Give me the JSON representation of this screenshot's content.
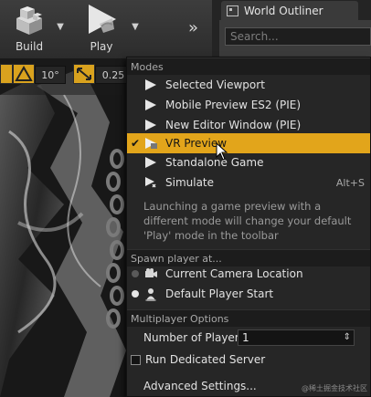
{
  "toolbar": {
    "build_label": "Build",
    "play_label": "Play",
    "overflow_glyph": "»",
    "dropdown_glyph": "▼"
  },
  "outliner": {
    "tab_title": "World Outliner",
    "search_placeholder": "Search..."
  },
  "viewport": {
    "angle_snap": "10°",
    "scale_snap": "0.25"
  },
  "menu": {
    "modes_header": "Modes",
    "modes": [
      {
        "label": "Selected Viewport",
        "icon": "play-icon",
        "checked": false,
        "shortcut": ""
      },
      {
        "label": "Mobile Preview ES2 (PIE)",
        "icon": "play-icon",
        "checked": false,
        "shortcut": ""
      },
      {
        "label": "New Editor Window (PIE)",
        "icon": "play-icon",
        "checked": false,
        "shortcut": ""
      },
      {
        "label": "VR Preview",
        "icon": "vr-headset-icon",
        "checked": true,
        "shortcut": ""
      },
      {
        "label": "Standalone Game",
        "icon": "play-icon",
        "checked": false,
        "shortcut": ""
      },
      {
        "label": "Simulate",
        "icon": "simulate-icon",
        "checked": false,
        "shortcut": "Alt+S"
      }
    ],
    "note": "Launching a game preview with a different mode will change your default 'Play' mode in the toolbar",
    "spawn_header": "Spawn player at...",
    "spawn": [
      {
        "label": "Current Camera Location",
        "icon": "camera-icon",
        "selected": false
      },
      {
        "label": "Default Player Start",
        "icon": "player-start-icon",
        "selected": true
      }
    ],
    "multiplayer_header": "Multiplayer Options",
    "players_label": "Number of Players",
    "players_value": "1",
    "dedicated_label": "Run Dedicated Server",
    "advanced_label": "Advanced Settings..."
  },
  "watermark": "@稀土掘金技术社区",
  "colors": {
    "accent": "#e2a51b",
    "menu_bg": "#262626",
    "header_bg": "#1c1c1c"
  }
}
